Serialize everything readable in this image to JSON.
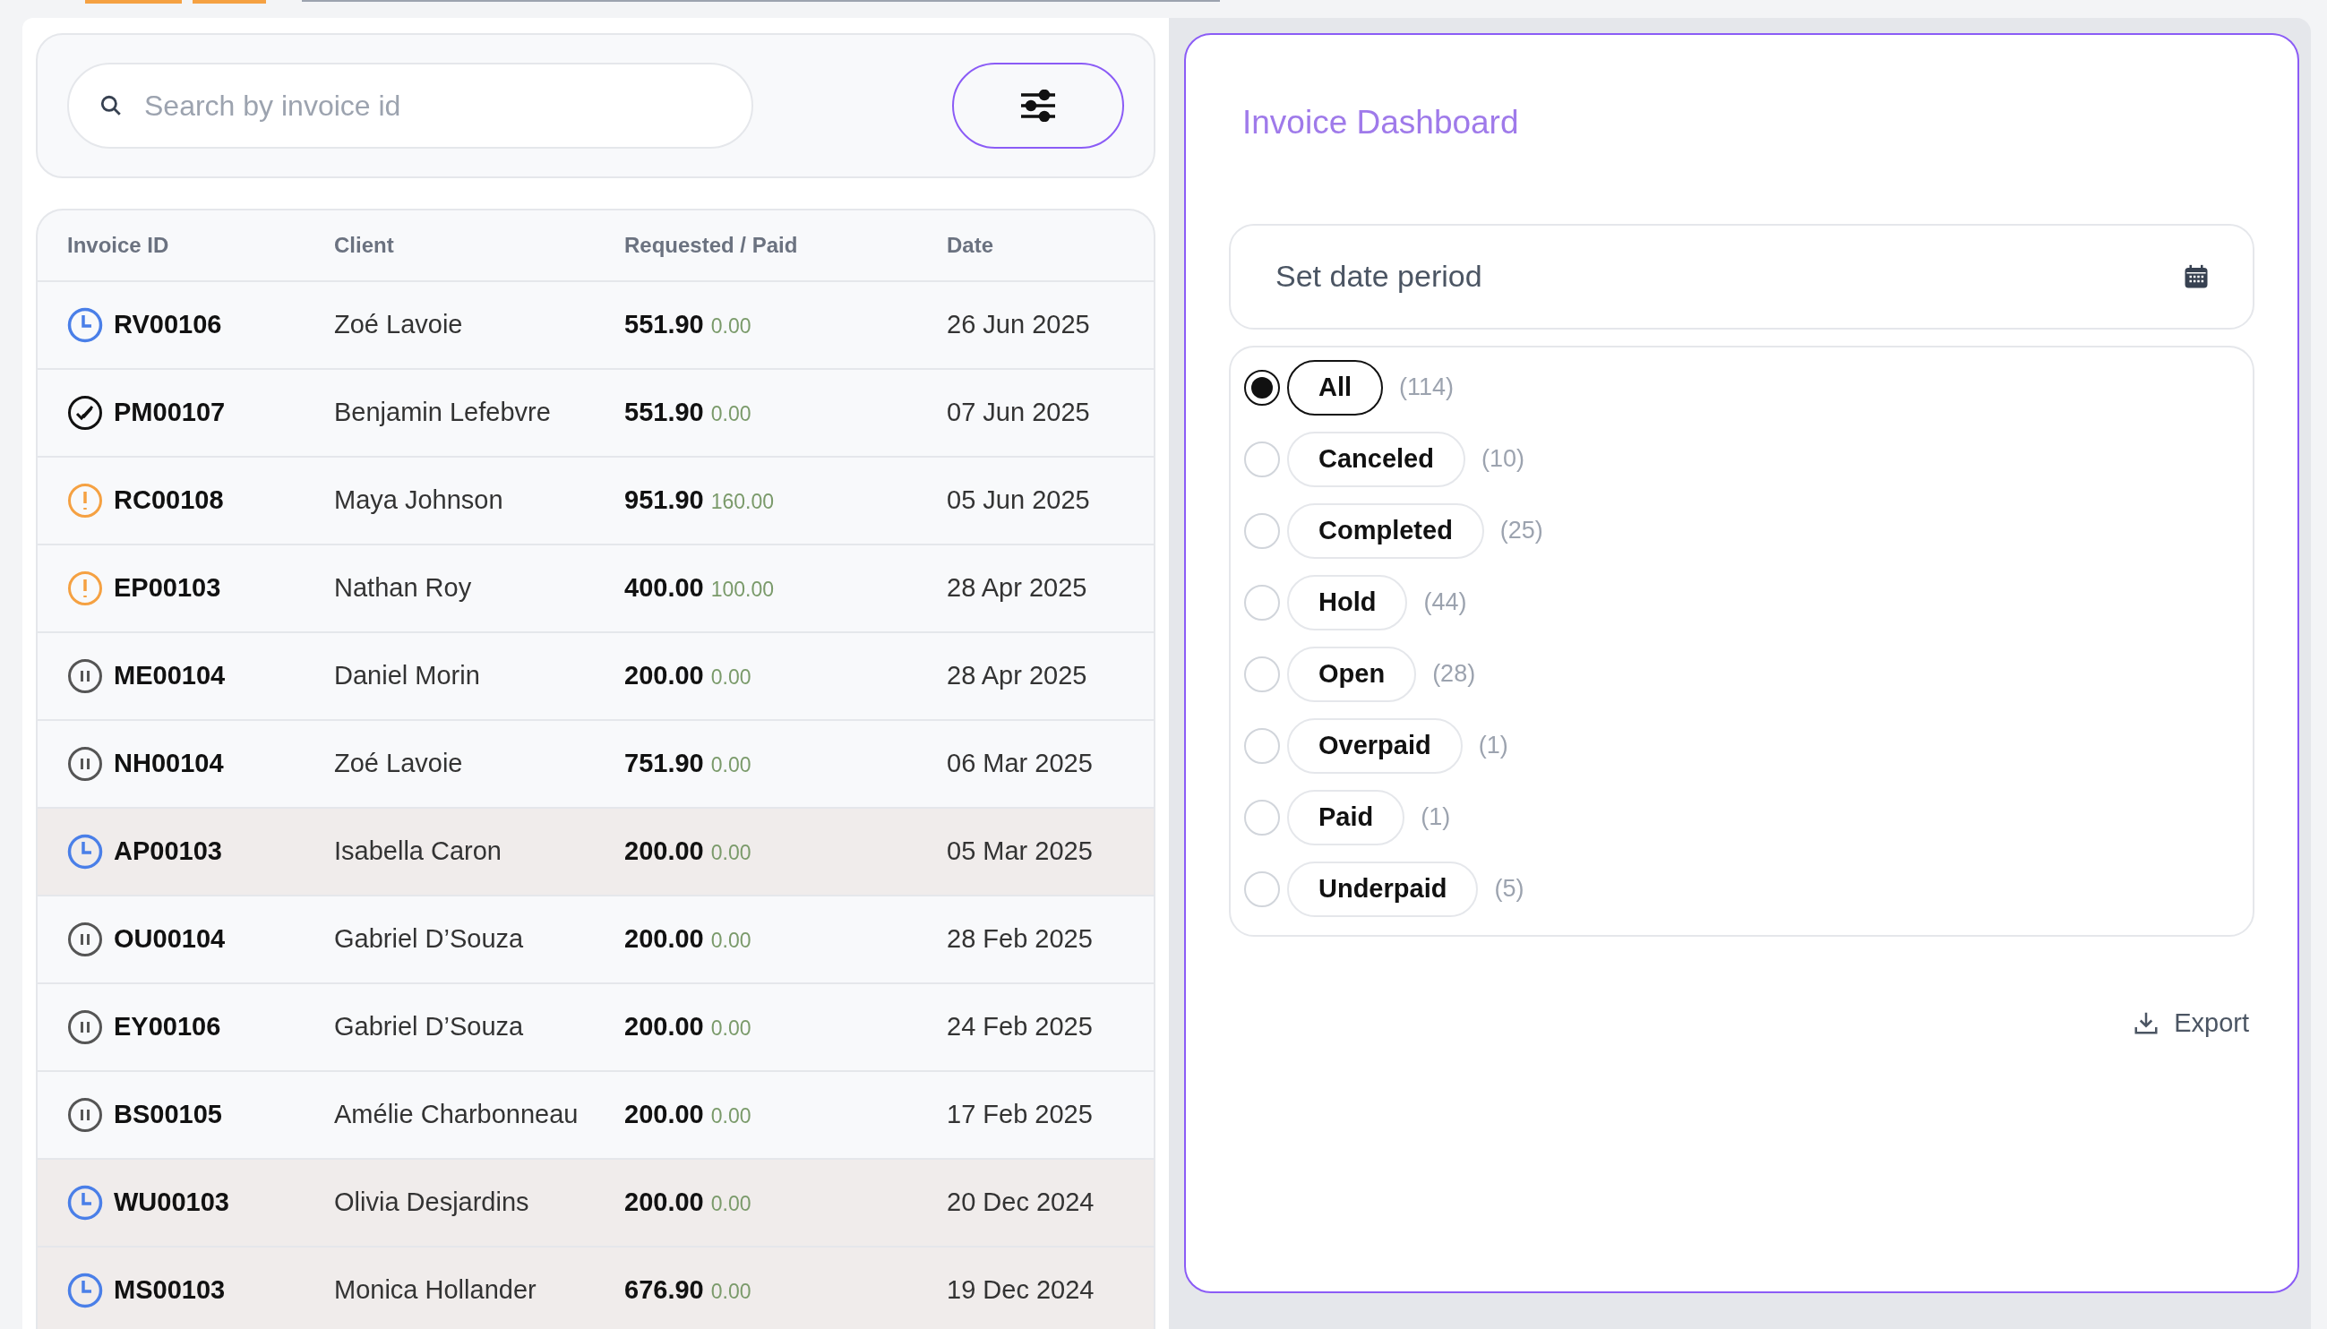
{
  "search": {
    "placeholder": "Search by invoice id"
  },
  "table": {
    "columns": [
      "Invoice ID",
      "Client",
      "Requested / Paid",
      "Date"
    ],
    "rows": [
      {
        "kind": "pending",
        "id": "RV00106",
        "client": "Zoé Lavoie",
        "requested": "551.90",
        "paid": "0.00",
        "date": "26 Jun 2025",
        "highlighted": false
      },
      {
        "kind": "completed",
        "id": "PM00107",
        "client": "Benjamin Lefebvre",
        "requested": "551.90",
        "paid": "0.00",
        "date": "07 Jun 2025",
        "highlighted": false
      },
      {
        "kind": "warning",
        "id": "RC00108",
        "client": "Maya Johnson",
        "requested": "951.90",
        "paid": "160.00",
        "date": "05 Jun 2025",
        "highlighted": false
      },
      {
        "kind": "warning",
        "id": "EP00103",
        "client": "Nathan Roy",
        "requested": "400.00",
        "paid": "100.00",
        "date": "28 Apr 2025",
        "highlighted": false
      },
      {
        "kind": "hold",
        "id": "ME00104",
        "client": "Daniel Morin",
        "requested": "200.00",
        "paid": "0.00",
        "date": "28 Apr 2025",
        "highlighted": false
      },
      {
        "kind": "hold",
        "id": "NH00104",
        "client": "Zoé Lavoie",
        "requested": "751.90",
        "paid": "0.00",
        "date": "06 Mar 2025",
        "highlighted": false
      },
      {
        "kind": "pending",
        "id": "AP00103",
        "client": "Isabella Caron",
        "requested": "200.00",
        "paid": "0.00",
        "date": "05 Mar 2025",
        "highlighted": true
      },
      {
        "kind": "hold",
        "id": "OU00104",
        "client": "Gabriel D’Souza",
        "requested": "200.00",
        "paid": "0.00",
        "date": "28 Feb 2025",
        "highlighted": false
      },
      {
        "kind": "hold",
        "id": "EY00106",
        "client": "Gabriel D’Souza",
        "requested": "200.00",
        "paid": "0.00",
        "date": "24 Feb 2025",
        "highlighted": false
      },
      {
        "kind": "hold",
        "id": "BS00105",
        "client": "Amélie Charbonneau",
        "requested": "200.00",
        "paid": "0.00",
        "date": "17 Feb 2025",
        "highlighted": false
      },
      {
        "kind": "pending",
        "id": "WU00103",
        "client": "Olivia Desjardins",
        "requested": "200.00",
        "paid": "0.00",
        "date": "20 Dec 2024",
        "highlighted": true
      },
      {
        "kind": "pending",
        "id": "MS00103",
        "client": "Monica Hollander",
        "requested": "676.90",
        "paid": "0.00",
        "date": "19 Dec 2024",
        "highlighted": true
      }
    ]
  },
  "dashboard": {
    "title": "Invoice Dashboard",
    "date_field": {
      "placeholder": "Set date period"
    },
    "filters": [
      {
        "label": "All",
        "count": "(114)",
        "selected": true
      },
      {
        "label": "Canceled",
        "count": "(10)",
        "selected": false
      },
      {
        "label": "Completed",
        "count": "(25)",
        "selected": false
      },
      {
        "label": "Hold",
        "count": "(44)",
        "selected": false
      },
      {
        "label": "Open",
        "count": "(28)",
        "selected": false
      },
      {
        "label": "Overpaid",
        "count": "(1)",
        "selected": false
      },
      {
        "label": "Paid",
        "count": "(1)",
        "selected": false
      },
      {
        "label": "Underpaid",
        "count": "(5)",
        "selected": false
      }
    ],
    "export": "Export"
  }
}
